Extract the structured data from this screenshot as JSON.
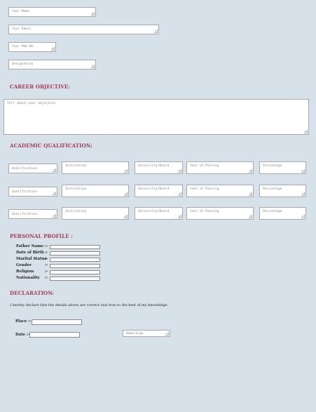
{
  "contact_fields": {
    "name_placeholder": "Your Name",
    "email_placeholder": "Your Email",
    "mobile_placeholder": "Your Mob No.",
    "designation_placeholder": "Designation"
  },
  "career_objective": {
    "heading": "CAREER OBJECTIVE:",
    "placeholder": "Tell about your objective"
  },
  "academic": {
    "heading": "ACADEMIC QUALIFICATION:",
    "rows": [
      {
        "qualification": "Qualification",
        "institution": "Institution",
        "university": "University/Board",
        "year": "Year of Passing",
        "percentage": "Percentage"
      },
      {
        "qualification": "Qualification",
        "institution": "Institution",
        "university": "University/Board",
        "year": "Year of Passing",
        "percentage": "Percentage"
      },
      {
        "qualification": "Qualification",
        "institution": "Institution",
        "university": "University/Board",
        "year": "Year of Passing",
        "percentage": "Percentage"
      }
    ]
  },
  "personal_profile": {
    "heading": "PERSONAL PROFILE :",
    "separator": ":-",
    "fields": [
      {
        "label": "Father Name"
      },
      {
        "label": "Date of Birth"
      },
      {
        "label": "Marital Status"
      },
      {
        "label": "Gender"
      },
      {
        "label": "Religion"
      },
      {
        "label": "Nationality"
      }
    ]
  },
  "declaration": {
    "heading": "DECLARATION:",
    "text": "I hereby declare that the details above are correct and true to the best of my knowledge.",
    "place_label": "Place :-",
    "date_label": "Date :-",
    "sign_placeholder": "Name/Sign"
  },
  "colors": {
    "background": "#d6e1ea",
    "heading": "#a83c57"
  }
}
